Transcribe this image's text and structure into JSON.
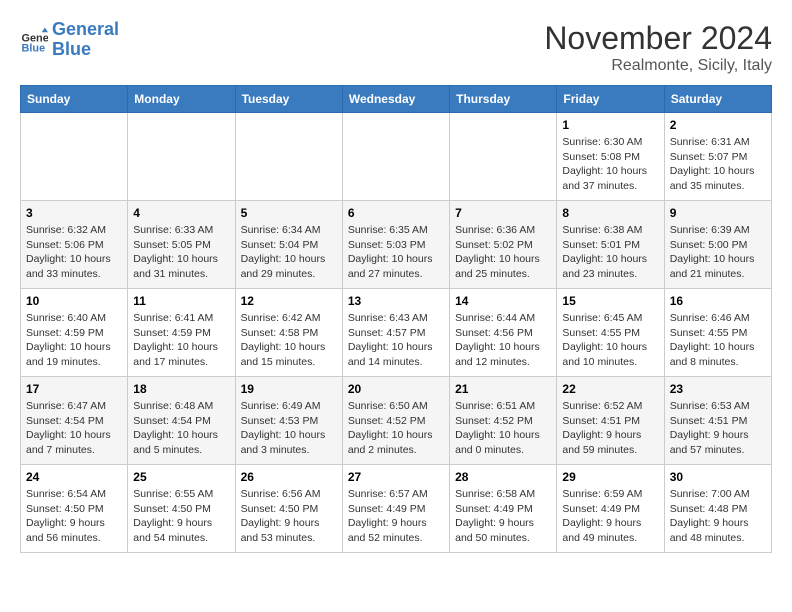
{
  "header": {
    "logo_line1": "General",
    "logo_line2": "Blue",
    "month": "November 2024",
    "location": "Realmonte, Sicily, Italy"
  },
  "weekdays": [
    "Sunday",
    "Monday",
    "Tuesday",
    "Wednesday",
    "Thursday",
    "Friday",
    "Saturday"
  ],
  "weeks": [
    [
      {
        "day": "",
        "info": ""
      },
      {
        "day": "",
        "info": ""
      },
      {
        "day": "",
        "info": ""
      },
      {
        "day": "",
        "info": ""
      },
      {
        "day": "",
        "info": ""
      },
      {
        "day": "1",
        "info": "Sunrise: 6:30 AM\nSunset: 5:08 PM\nDaylight: 10 hours\nand 37 minutes."
      },
      {
        "day": "2",
        "info": "Sunrise: 6:31 AM\nSunset: 5:07 PM\nDaylight: 10 hours\nand 35 minutes."
      }
    ],
    [
      {
        "day": "3",
        "info": "Sunrise: 6:32 AM\nSunset: 5:06 PM\nDaylight: 10 hours\nand 33 minutes."
      },
      {
        "day": "4",
        "info": "Sunrise: 6:33 AM\nSunset: 5:05 PM\nDaylight: 10 hours\nand 31 minutes."
      },
      {
        "day": "5",
        "info": "Sunrise: 6:34 AM\nSunset: 5:04 PM\nDaylight: 10 hours\nand 29 minutes."
      },
      {
        "day": "6",
        "info": "Sunrise: 6:35 AM\nSunset: 5:03 PM\nDaylight: 10 hours\nand 27 minutes."
      },
      {
        "day": "7",
        "info": "Sunrise: 6:36 AM\nSunset: 5:02 PM\nDaylight: 10 hours\nand 25 minutes."
      },
      {
        "day": "8",
        "info": "Sunrise: 6:38 AM\nSunset: 5:01 PM\nDaylight: 10 hours\nand 23 minutes."
      },
      {
        "day": "9",
        "info": "Sunrise: 6:39 AM\nSunset: 5:00 PM\nDaylight: 10 hours\nand 21 minutes."
      }
    ],
    [
      {
        "day": "10",
        "info": "Sunrise: 6:40 AM\nSunset: 4:59 PM\nDaylight: 10 hours\nand 19 minutes."
      },
      {
        "day": "11",
        "info": "Sunrise: 6:41 AM\nSunset: 4:59 PM\nDaylight: 10 hours\nand 17 minutes."
      },
      {
        "day": "12",
        "info": "Sunrise: 6:42 AM\nSunset: 4:58 PM\nDaylight: 10 hours\nand 15 minutes."
      },
      {
        "day": "13",
        "info": "Sunrise: 6:43 AM\nSunset: 4:57 PM\nDaylight: 10 hours\nand 14 minutes."
      },
      {
        "day": "14",
        "info": "Sunrise: 6:44 AM\nSunset: 4:56 PM\nDaylight: 10 hours\nand 12 minutes."
      },
      {
        "day": "15",
        "info": "Sunrise: 6:45 AM\nSunset: 4:55 PM\nDaylight: 10 hours\nand 10 minutes."
      },
      {
        "day": "16",
        "info": "Sunrise: 6:46 AM\nSunset: 4:55 PM\nDaylight: 10 hours\nand 8 minutes."
      }
    ],
    [
      {
        "day": "17",
        "info": "Sunrise: 6:47 AM\nSunset: 4:54 PM\nDaylight: 10 hours\nand 7 minutes."
      },
      {
        "day": "18",
        "info": "Sunrise: 6:48 AM\nSunset: 4:54 PM\nDaylight: 10 hours\nand 5 minutes."
      },
      {
        "day": "19",
        "info": "Sunrise: 6:49 AM\nSunset: 4:53 PM\nDaylight: 10 hours\nand 3 minutes."
      },
      {
        "day": "20",
        "info": "Sunrise: 6:50 AM\nSunset: 4:52 PM\nDaylight: 10 hours\nand 2 minutes."
      },
      {
        "day": "21",
        "info": "Sunrise: 6:51 AM\nSunset: 4:52 PM\nDaylight: 10 hours\nand 0 minutes."
      },
      {
        "day": "22",
        "info": "Sunrise: 6:52 AM\nSunset: 4:51 PM\nDaylight: 9 hours\nand 59 minutes."
      },
      {
        "day": "23",
        "info": "Sunrise: 6:53 AM\nSunset: 4:51 PM\nDaylight: 9 hours\nand 57 minutes."
      }
    ],
    [
      {
        "day": "24",
        "info": "Sunrise: 6:54 AM\nSunset: 4:50 PM\nDaylight: 9 hours\nand 56 minutes."
      },
      {
        "day": "25",
        "info": "Sunrise: 6:55 AM\nSunset: 4:50 PM\nDaylight: 9 hours\nand 54 minutes."
      },
      {
        "day": "26",
        "info": "Sunrise: 6:56 AM\nSunset: 4:50 PM\nDaylight: 9 hours\nand 53 minutes."
      },
      {
        "day": "27",
        "info": "Sunrise: 6:57 AM\nSunset: 4:49 PM\nDaylight: 9 hours\nand 52 minutes."
      },
      {
        "day": "28",
        "info": "Sunrise: 6:58 AM\nSunset: 4:49 PM\nDaylight: 9 hours\nand 50 minutes."
      },
      {
        "day": "29",
        "info": "Sunrise: 6:59 AM\nSunset: 4:49 PM\nDaylight: 9 hours\nand 49 minutes."
      },
      {
        "day": "30",
        "info": "Sunrise: 7:00 AM\nSunset: 4:48 PM\nDaylight: 9 hours\nand 48 minutes."
      }
    ]
  ]
}
